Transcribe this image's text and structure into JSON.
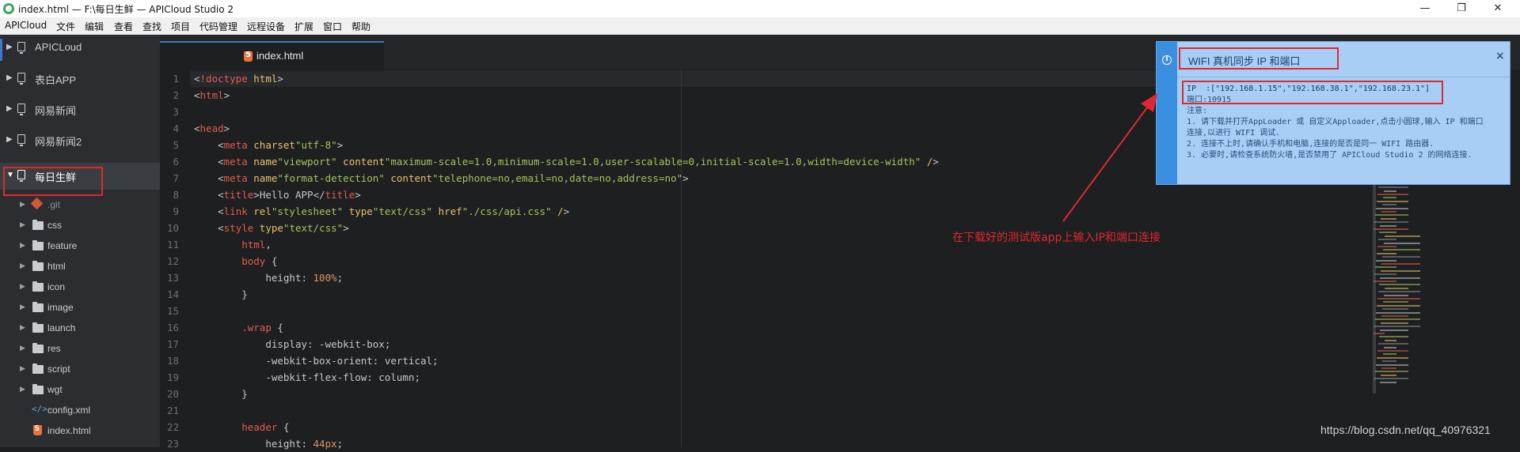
{
  "window": {
    "title": "index.html — F:\\每日生鲜 — APICloud Studio 2",
    "minimize": "—",
    "restore": "❐",
    "close": "✕"
  },
  "menu": [
    "APICloud",
    "文件",
    "编辑",
    "查看",
    "查找",
    "项目",
    "代码管理",
    "远程设备",
    "扩展",
    "窗口",
    "帮助"
  ],
  "sidebar": {
    "projects": [
      "APICLoud",
      "表白APP",
      "网易新闻",
      "网易新闻2",
      "每日生鲜"
    ],
    "active_project": "每日生鲜",
    "tree": [
      ".git",
      "css",
      "feature",
      "html",
      "icon",
      "image",
      "launch",
      "res",
      "script",
      "wgt",
      "config.xml",
      "index.html"
    ]
  },
  "editor": {
    "tab_label": "index.html",
    "line_numbers": [
      "1",
      "2",
      "3",
      "4",
      "5",
      "6",
      "7",
      "8",
      "9",
      "10",
      "11",
      "12",
      "13",
      "14",
      "15",
      "16",
      "17",
      "18",
      "19",
      "20",
      "21",
      "22",
      "23"
    ],
    "lines": [
      "<!doctype html>",
      "<html>",
      "",
      "<head>",
      "    <meta charset=\"utf-8\">",
      "    <meta name=\"viewport\" content=\"maximum-scale=1.0,minimum-scale=1.0,user-scalable=0,initial-scale=1.0,width=device-width\" />",
      "    <meta name=\"format-detection\" content=\"telephone=no,email=no,date=no,address=no\">",
      "    <title>Hello APP</title>",
      "    <link rel=\"stylesheet\" type=\"text/css\" href=\"./css/api.css\" />",
      "    <style type=\"text/css\">",
      "        html,",
      "        body {",
      "            height: 100%;",
      "        }",
      "",
      "        .wrap {",
      "            display: -webkit-box;",
      "            -webkit-box-orient: vertical;",
      "            -webkit-flex-flow: column;",
      "        }",
      "",
      "        header {",
      "            height: 44px;"
    ]
  },
  "popup": {
    "title": "WIFI 真机同步 IP 和端口",
    "close": "×",
    "ip_line": "IP  :[\"192.168.1.15\",\"192.168.38.1\",\"192.168.23.1\"]",
    "port_line": "端口:10915",
    "notes_header": "注意:",
    "notes": [
      "1. 请下载并打开AppLoader 或 自定义Apploader,点击小圆球,输入 IP 和端口",
      "连接,以进行 WIFI 调试.",
      "2. 连接不上时,请确认手机和电脑,连接的是否是同一 WIFI 路由器.",
      "3. 必要时,请检查系统防火墙,是否禁用了 APICloud Studio 2 的网络连接."
    ]
  },
  "annotation": "在下载好的测试版app上输入IP和端口连接",
  "watermark": "https://blog.csdn.net/qq_40976321",
  "colors": {
    "editor_bg": "#1d1f21",
    "sidebar_bg": "#2b2d30",
    "tag": "#e35c4c",
    "attr": "#e9c26a",
    "string": "#a4c45a",
    "number": "#de935f",
    "popup_bg": "#a8cef5",
    "annotation_red": "#e0282e"
  }
}
